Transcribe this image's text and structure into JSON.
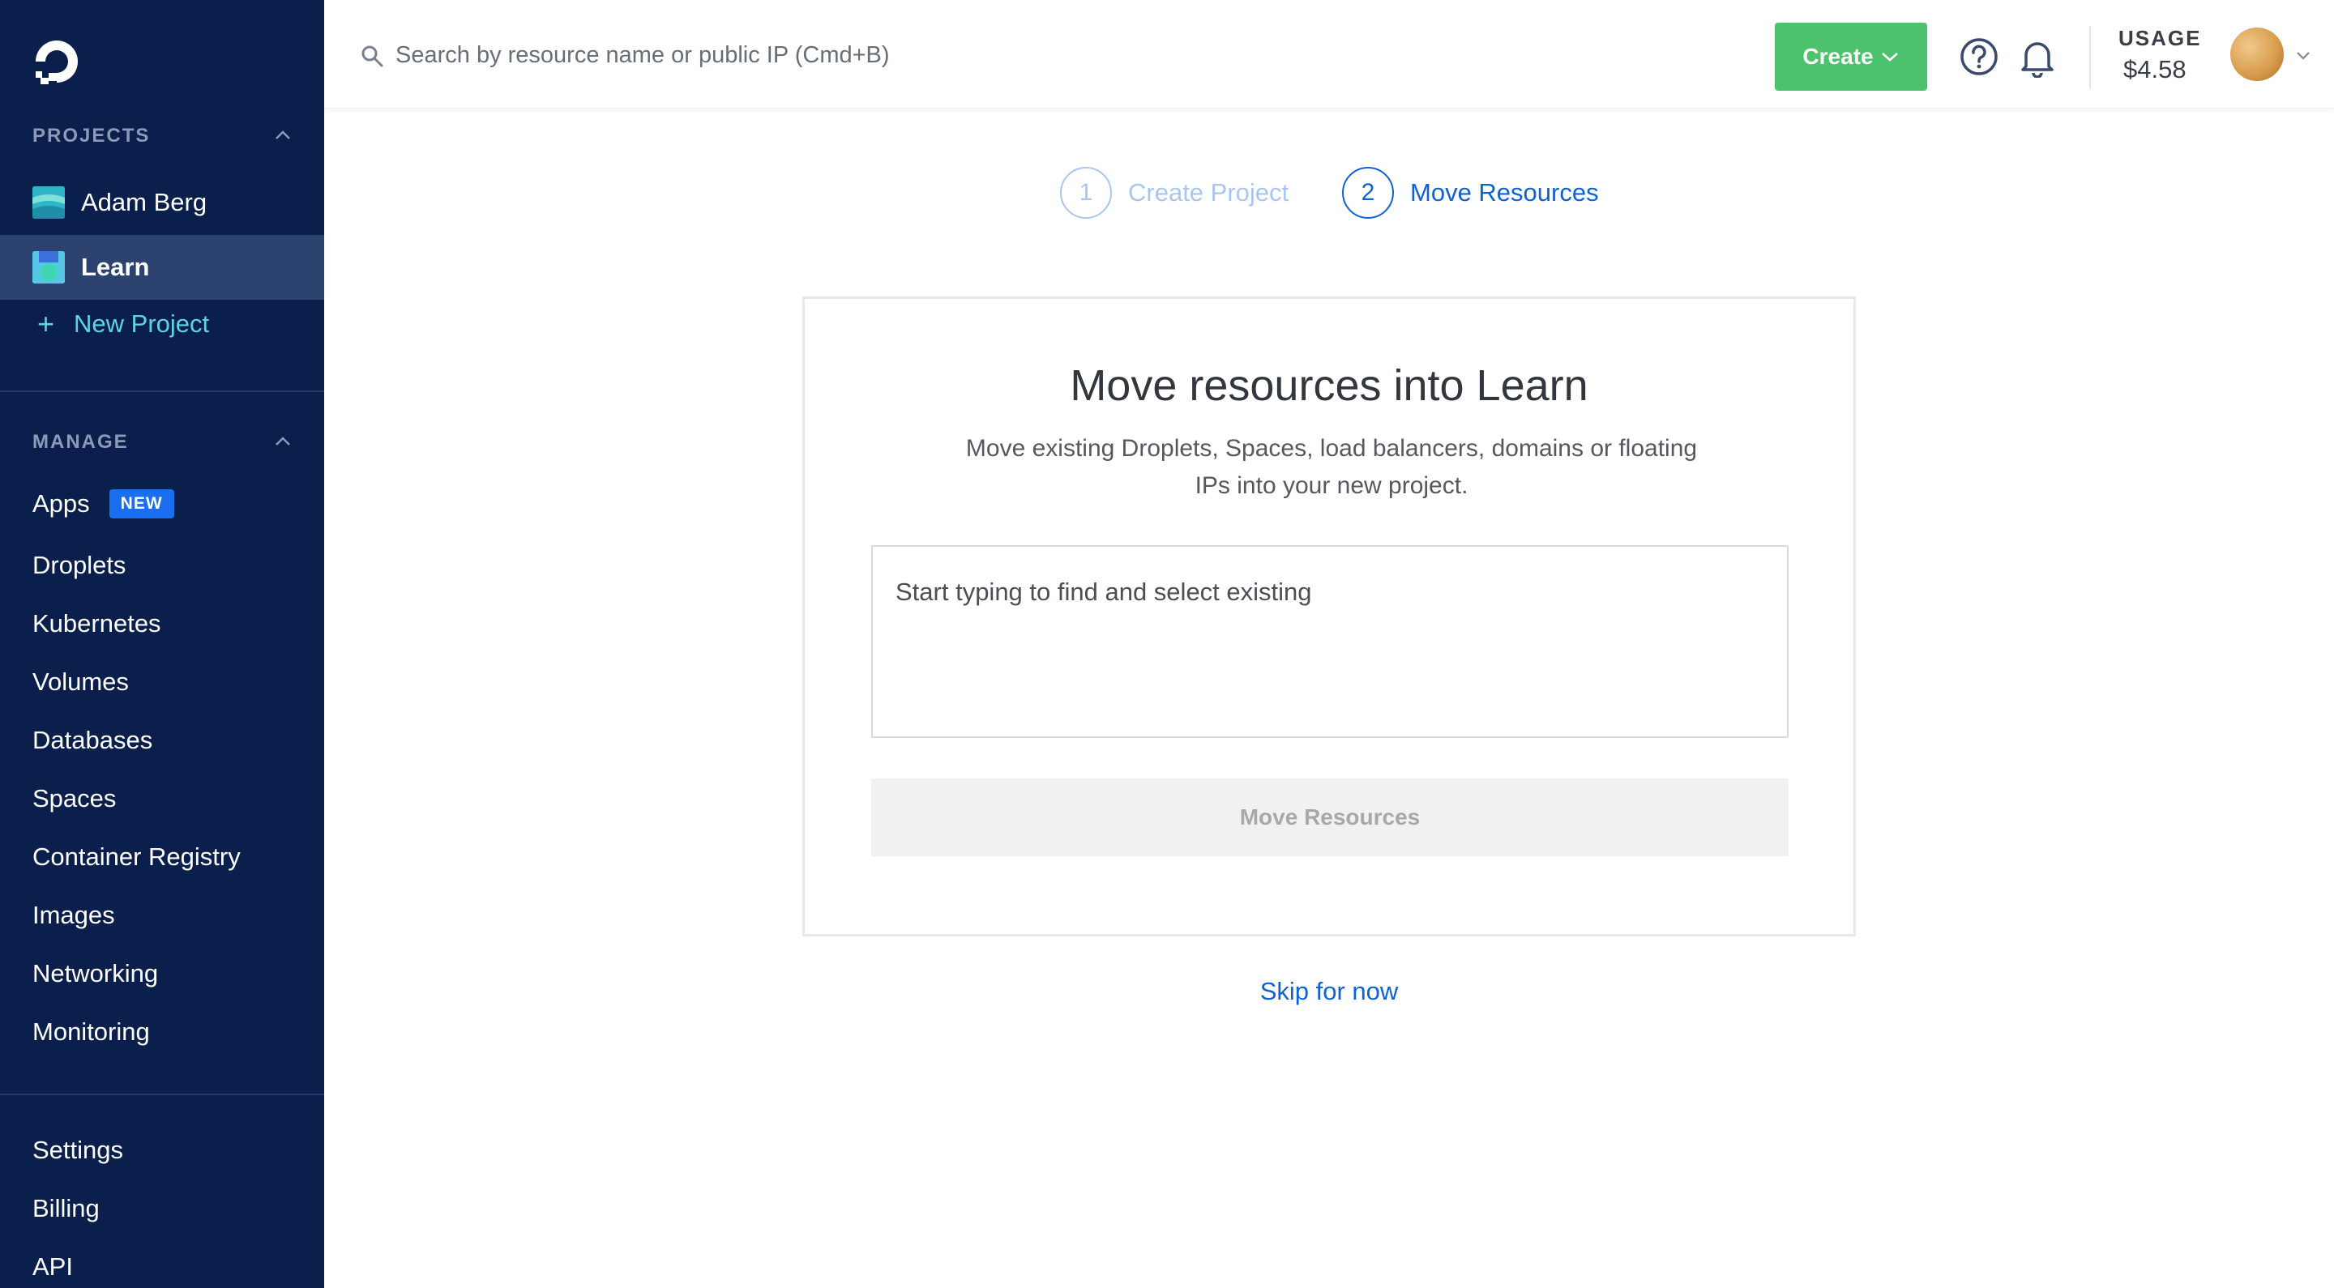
{
  "sidebar": {
    "projects_header": "PROJECTS",
    "projects": [
      {
        "label": "Adam Berg",
        "active": false
      },
      {
        "label": "Learn",
        "active": true
      }
    ],
    "new_project": "New Project",
    "manage_header": "MANAGE",
    "nav": [
      {
        "label": "Apps",
        "badge": "NEW"
      },
      {
        "label": "Droplets"
      },
      {
        "label": "Kubernetes"
      },
      {
        "label": "Volumes"
      },
      {
        "label": "Databases"
      },
      {
        "label": "Spaces"
      },
      {
        "label": "Container Registry"
      },
      {
        "label": "Images"
      },
      {
        "label": "Networking"
      },
      {
        "label": "Monitoring"
      }
    ],
    "bottom_nav": [
      {
        "label": "Settings"
      },
      {
        "label": "Billing"
      },
      {
        "label": "API"
      }
    ]
  },
  "topbar": {
    "search_placeholder": "Search by resource name or public IP (Cmd+B)",
    "create_label": "Create",
    "usage_label": "USAGE",
    "usage_value": "$4.58"
  },
  "stepper": [
    {
      "number": "1",
      "label": "Create Project",
      "state": "done"
    },
    {
      "number": "2",
      "label": "Move Resources",
      "state": "active"
    }
  ],
  "card": {
    "title": "Move resources into Learn",
    "description": "Move existing Droplets, Spaces, load balancers, domains or floating IPs into your new project.",
    "input_placeholder": "Start typing to find and select existing",
    "button_label": "Move Resources"
  },
  "skip_label": "Skip for now",
  "colors": {
    "sidebar_bg": "#0b1f4d",
    "sidebar_active": "#2c4370",
    "accent_blue": "#0f61d6",
    "create_green": "#4dc26d",
    "new_project_cyan": "#5fd2e8",
    "badge_blue": "#1a6ff0"
  }
}
